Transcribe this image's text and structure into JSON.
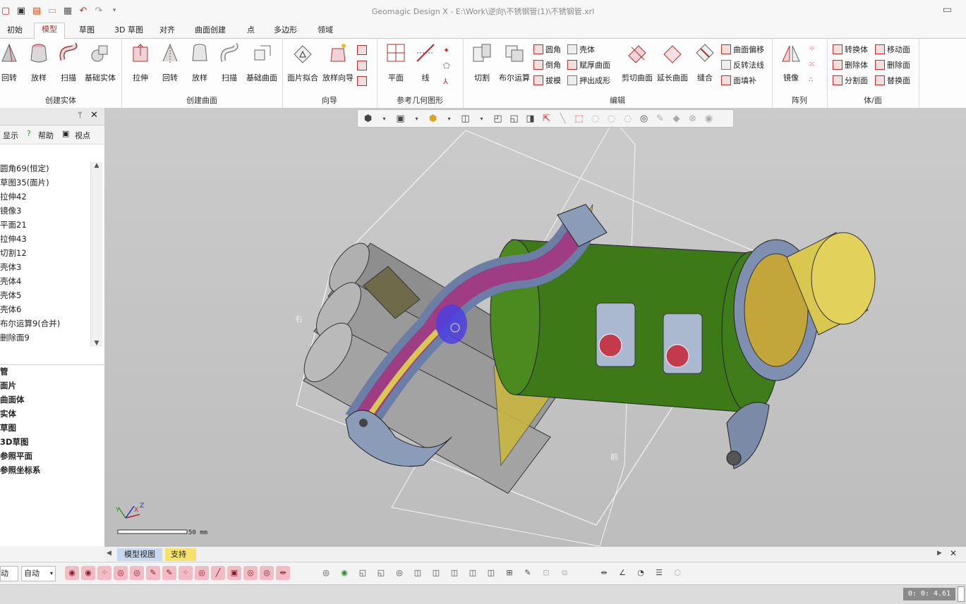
{
  "window": {
    "title": "Geomagic Design X - E:\\Work\\逆向\\不锈钢管(1)\\不锈钢管.xrl",
    "restore_icon": "restore-icon"
  },
  "quick_access": [
    "new-icon",
    "save-icon",
    "import-icon",
    "open-icon",
    "export-icon",
    "undo-icon",
    "redo-icon",
    "dropdown-icon"
  ],
  "tabs": [
    {
      "label": "初始",
      "active": false
    },
    {
      "label": "模型",
      "active": true
    },
    {
      "label": "草图",
      "active": false
    },
    {
      "label": "3D 草图",
      "active": false
    },
    {
      "label": "对齐",
      "active": false
    },
    {
      "label": "曲面创建",
      "active": false
    },
    {
      "label": "点",
      "active": false
    },
    {
      "label": "多边形",
      "active": false
    },
    {
      "label": "领域",
      "active": false
    }
  ],
  "ribbon": {
    "groups": [
      {
        "label": "创建实体",
        "big": [
          "回转",
          "放样",
          "扫描",
          "基础实体"
        ]
      },
      {
        "label": "创建曲面",
        "big": [
          "拉伸",
          "回转",
          "放样",
          "扫描",
          "基础曲面"
        ]
      },
      {
        "label": "向导",
        "big": [
          "面片拟合",
          "放样向导"
        ]
      },
      {
        "label": "参考几何图形",
        "big": [
          "平面",
          "线"
        ]
      },
      {
        "label": "编辑",
        "big": [
          "切割",
          "布尔运算"
        ],
        "small": [
          "圆角",
          "倒角",
          "拔模",
          "壳体",
          "赋厚曲面",
          "押出成形"
        ],
        "big2": [
          "剪切曲面",
          "延长曲面",
          "缝合"
        ],
        "small2": [
          "曲面偏移",
          "反转法线",
          "面填补"
        ]
      },
      {
        "label": "阵列",
        "big": [
          "镜像"
        ]
      },
      {
        "label": "体/面",
        "small": [
          "转换体",
          "删除体",
          "分割面",
          "移动面",
          "删除面",
          "替换面"
        ]
      }
    ]
  },
  "left_panel": {
    "toolbar": [
      "显示",
      "帮助",
      "视点"
    ],
    "features": [
      "圆角69(恒定)",
      "草图35(面片)",
      "拉伸42",
      "镜像3",
      "平面21",
      "拉伸43",
      "切割12",
      "壳体3",
      "壳体4",
      "壳体5",
      "壳体6",
      "布尔运算9(合并)",
      "删除面9"
    ],
    "categories": [
      "管",
      "面片",
      "曲面体",
      "实体",
      "草图",
      "3D草图",
      "参照平面",
      "参照坐标系"
    ]
  },
  "viewport": {
    "labels": {
      "right": "右",
      "front": "前"
    },
    "scale_text": "50 mm",
    "axes": {
      "x": "X",
      "y": "Y",
      "z": "Z"
    },
    "colors": {
      "green": "#3d7a17",
      "yellow": "#d6c24a",
      "steel": "#8a9cb8",
      "magenta": "#a8264a",
      "gray": "#8e8e8e"
    }
  },
  "view_tabs": [
    "模型视图",
    "支持"
  ],
  "status": {
    "mode1": "动",
    "mode2": "自动",
    "time": "0: 0: 4.61"
  }
}
